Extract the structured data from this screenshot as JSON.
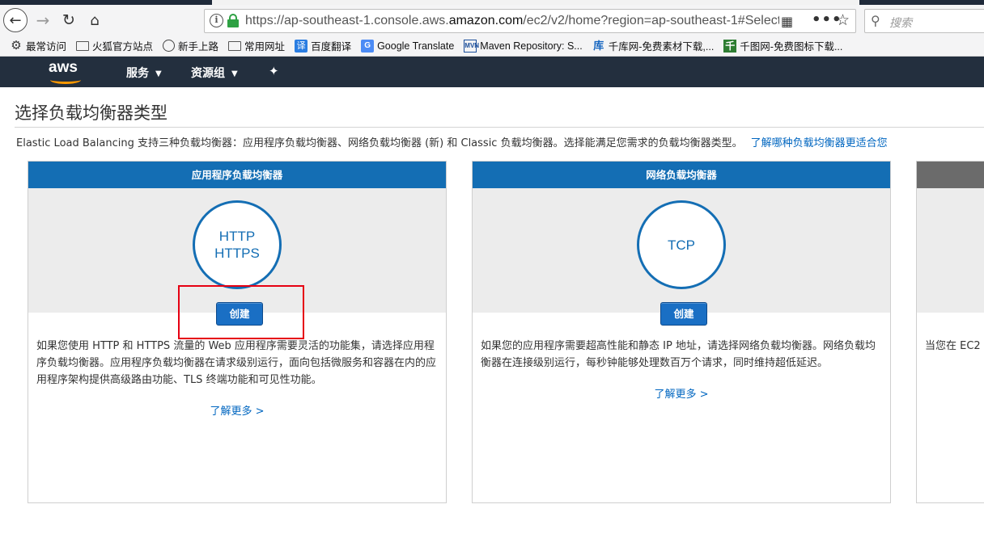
{
  "browser": {
    "url_prefix": "https://ap-southeast-1.console.aws.",
    "url_host": "amazon.com",
    "url_suffix": "/ec2/v2/home?region=ap-southeast-1#Select",
    "search_placeholder": "搜索",
    "icons": {
      "back": "back-arrow-icon",
      "forward": "forward-arrow-icon",
      "reload": "reload-icon",
      "home": "home-icon",
      "info": "info-icon",
      "lock": "lock-icon",
      "qr": "qr-code-icon",
      "more": "more-dots-icon",
      "star": "bookmark-star-icon",
      "search": "search-icon"
    }
  },
  "bookmarks": [
    {
      "label": "最常访问",
      "icon": "gear-icon"
    },
    {
      "label": "火狐官方站点",
      "icon": "folder-icon"
    },
    {
      "label": "新手上路",
      "icon": "globe-icon"
    },
    {
      "label": "常用网址",
      "icon": "folder-icon"
    },
    {
      "label": "百度翻译",
      "icon": "translate-icon"
    },
    {
      "label": "Google Translate",
      "icon": "google-translate-icon"
    },
    {
      "label": "Maven Repository: S...",
      "icon": "maven-icon"
    },
    {
      "label": "千库网-免费素材下载,...",
      "icon": "qianku-icon"
    },
    {
      "label": "千图网-免费图标下载...",
      "icon": "qiantu-icon"
    }
  ],
  "aws": {
    "logo_text": "aws",
    "menu": {
      "services": "服务",
      "resource_groups": "资源组"
    }
  },
  "page": {
    "title": "选择负载均衡器类型",
    "intro": "Elastic Load Balancing 支持三种负载均衡器：应用程序负载均衡器、网络负载均衡器 (新) 和 Classic 负载均衡器。选择能满足您需求的负载均衡器类型。",
    "intro_link": "了解哪种负载均衡器更适合您"
  },
  "cards": [
    {
      "header": "应用程序负载均衡器",
      "protocols": [
        "HTTP",
        "HTTPS"
      ],
      "button": "创建",
      "description": "如果您使用 HTTP 和 HTTPS 流量的 Web 应用程序需要灵活的功能集，请选择应用程序负载均衡器。应用程序负载均衡器在请求级别运行，面向包括微服务和容器在内的应用程序架构提供高级路由功能、TLS 终端功能和可见性功能。",
      "learn_more": "了解更多 >"
    },
    {
      "header": "网络负载均衡器",
      "protocols": [
        "TCP"
      ],
      "button": "创建",
      "description": "如果您的应用程序需要超高性能和静态 IP 地址，请选择网络负载均衡器。网络负载均衡器在连接级别运行，每秒钟能够处理数百万个请求，同时维持超低延迟。",
      "learn_more": "了解更多 >"
    },
    {
      "header": "",
      "description": "当您在 EC2"
    }
  ],
  "colors": {
    "aws_header": "#232f3e",
    "card_header": "#146eb4",
    "link": "#0066c0",
    "highlight": "#e60012"
  }
}
